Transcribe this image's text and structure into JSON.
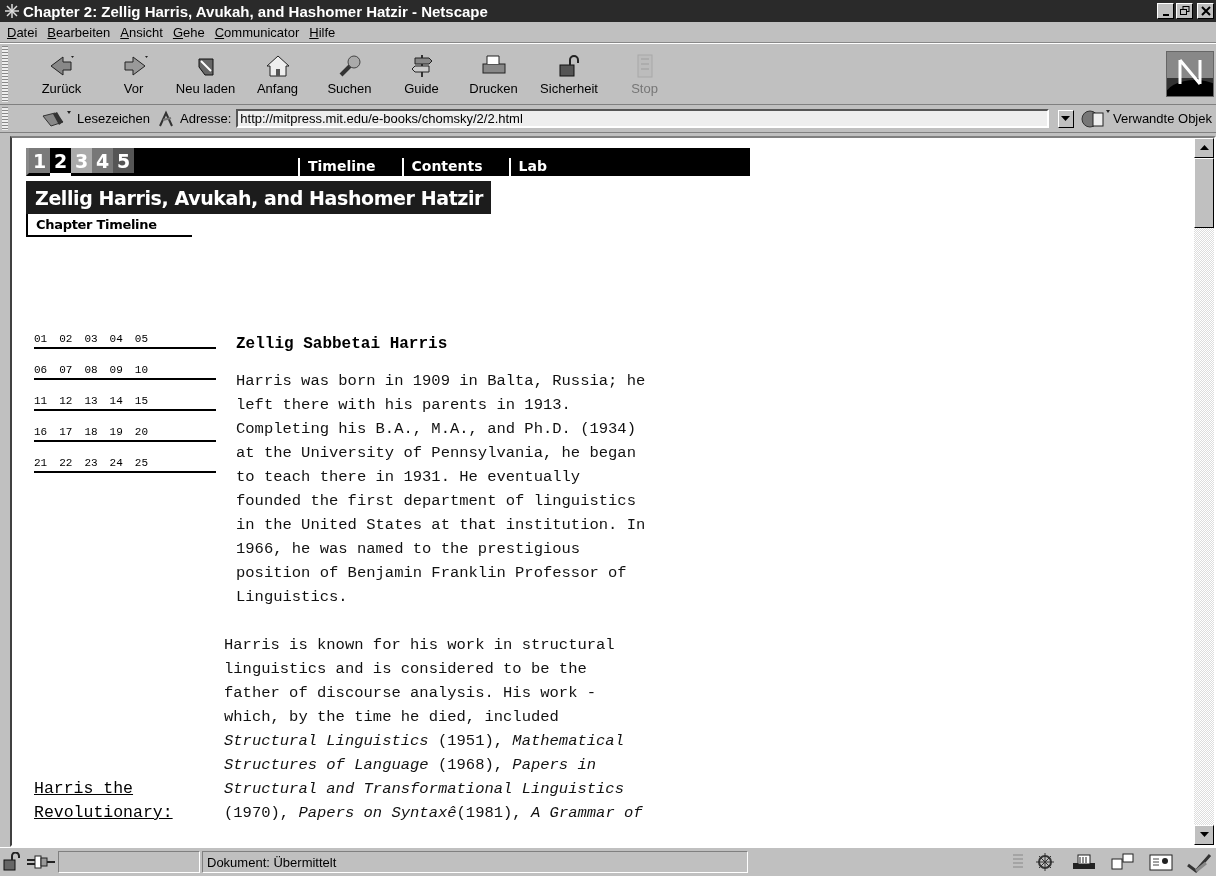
{
  "window": {
    "title": "Chapter 2: Zellig Harris, Avukah, and Hashomer Hatzir - Netscape"
  },
  "menu": [
    "Datei",
    "Bearbeiten",
    "Ansicht",
    "Gehe",
    "Communicator",
    "Hilfe"
  ],
  "toolbar": [
    {
      "kind": "back",
      "label": "Zurück",
      "disabled": false
    },
    {
      "kind": "forward",
      "label": "Vor",
      "disabled": false
    },
    {
      "kind": "reload",
      "label": "Neu laden",
      "disabled": false
    },
    {
      "kind": "home",
      "label": "Anfang",
      "disabled": false
    },
    {
      "kind": "search",
      "label": "Suchen",
      "disabled": false
    },
    {
      "kind": "guide",
      "label": "Guide",
      "disabled": false
    },
    {
      "kind": "print",
      "label": "Drucken",
      "disabled": false
    },
    {
      "kind": "security",
      "label": "Sicherheit",
      "disabled": false
    },
    {
      "kind": "stop",
      "label": "Stop",
      "disabled": true
    }
  ],
  "location": {
    "bookmarks": "Lesezeichen",
    "address_label": "Adresse:",
    "url": "http://mitpress.mit.edu/e-books/chomsky/2/2.html",
    "related": "Verwandte Objek"
  },
  "page": {
    "chapters": [
      {
        "label": "1",
        "selected": false,
        "color": "#7a7a7a"
      },
      {
        "label": "2",
        "selected": true,
        "color": "#000000"
      },
      {
        "label": "3",
        "selected": false,
        "color": "#aaaaaa"
      },
      {
        "label": "4",
        "selected": false,
        "color": "#777777"
      },
      {
        "label": "5",
        "selected": false,
        "color": "#555555"
      }
    ],
    "nav": [
      "Timeline",
      "Contents",
      "Lab"
    ],
    "chapter_title": "Zellig Harris, Avukah, and Hashomer Hatzir",
    "subtitle": "Chapter Timeline",
    "timeline_numbers": [
      [
        "01",
        "02",
        "03",
        "04",
        "05"
      ],
      [
        "06",
        "07",
        "08",
        "09",
        "10"
      ],
      [
        "11",
        "12",
        "13",
        "14",
        "15"
      ],
      [
        "16",
        "17",
        "18",
        "19",
        "20"
      ],
      [
        "21",
        "22",
        "23",
        "24",
        "25"
      ]
    ],
    "heading": "Zellig Sabbetai Harris",
    "paragraphs": [
      "Harris was born in 1909 in Balta, Russia; he\nleft there with his parents in 1913.\nCompleting his B.A., M.A., and Ph.D. (1934)\nat the University of Pennsylvania, he began\nto teach there in 1931. He eventually\nfounded the first department of linguistics\nin the United States at that institution. In\n1966, he was named to the prestigious\nposition of Benjamin Franklin Professor of\nLinguistics.",
      "Harris is known for his work in structural\nlinguistics and is considered to be the\nfather of discourse analysis. His work -\nwhich, by the time he died, included\n*Structural Linguistics* (1951), *Mathematical*\n*Structures of Language* (1968), *Papers in*\n*Structural and Transformational Linguistics*\n(1970), *Papers on Syntaxê*(1981), *A Grammar of*"
    ],
    "side_link": "Harris the\nRevolutionary:"
  },
  "status_bar": {
    "text": "Dokument: Übermittelt"
  }
}
